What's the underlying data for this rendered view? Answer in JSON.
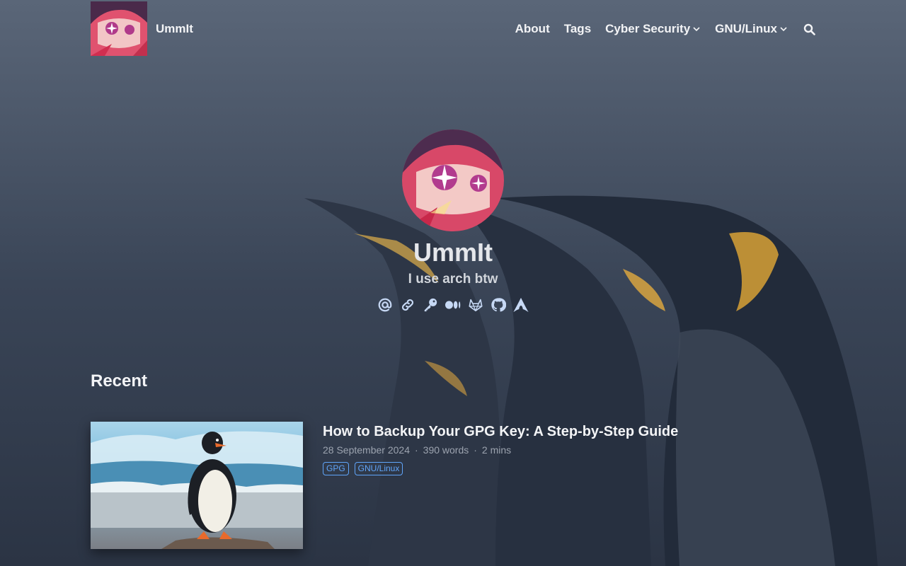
{
  "site": {
    "name": "UmmIt"
  },
  "nav": {
    "items": [
      {
        "label": "About"
      },
      {
        "label": "Tags"
      },
      {
        "label": "Cyber Security",
        "has_dropdown": true
      },
      {
        "label": "GNU/Linux",
        "has_dropdown": true
      }
    ],
    "search_icon": "search-icon"
  },
  "hero": {
    "name": "UmmIt",
    "tagline": "I use arch btw",
    "social_icons": [
      "email-icon",
      "link-icon",
      "key-icon",
      "medium-icon",
      "gitlab-icon",
      "github-icon",
      "arch-linux-icon"
    ]
  },
  "recent": {
    "heading": "Recent",
    "articles": [
      {
        "title": "How to Backup Your GPG Key: A Step-by-Step Guide",
        "date": "28 September 2024",
        "words": "390 words",
        "reading_time": "2 mins",
        "tags": [
          "GPG",
          "GNU/Linux"
        ]
      }
    ]
  },
  "colors": {
    "background_overlay": "#3e4a5c",
    "accent": "#60a5fa",
    "text": "#f3f4f6",
    "meta_text": "#9ca3af",
    "social_icon": "#c7d9f5"
  }
}
